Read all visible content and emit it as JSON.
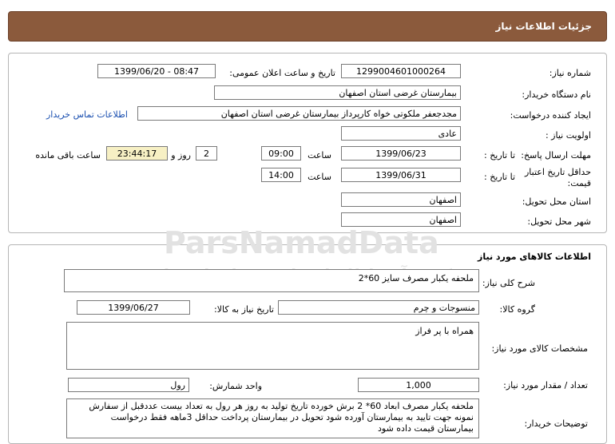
{
  "header": {
    "title": "جزئیات اطلاعات نیاز"
  },
  "info": {
    "need_number_label": "شماره نیاز:",
    "need_number": "1299004601000264",
    "announce_label": "تاریخ و ساعت اعلان عمومی:",
    "announce_value": "1399/06/20 - 08:47",
    "buyer_org_label": "نام دستگاه خریدار:",
    "buyer_org": "بیمارستان غرضی استان اصفهان",
    "creator_label": "ایجاد کننده درخواست:",
    "creator": "مجدجعفر ملکوتی خواه کارپرداز بیمارستان غرضی استان اصفهان",
    "contact_link": "اطلاعات تماس خریدار",
    "priority_label": "اولویت نیاز :",
    "priority": "عادی",
    "deadline_label": "مهلت ارسال پاسخ:",
    "until_date_label": "تا تاریخ :",
    "deadline_date": "1399/06/23",
    "time_label": "ساعت",
    "deadline_time": "09:00",
    "days": "2",
    "days_label": "روز و",
    "remaining_time": "23:44:17",
    "remaining_label": "ساعت باقی مانده",
    "validity_label": "حداقل تاریخ اعتبار قیمت:",
    "validity_date": "1399/06/31",
    "validity_time": "14:00",
    "province_label": "استان محل تحویل:",
    "province": "اصفهان",
    "city_label": "شهر محل تحویل:",
    "city": "اصفهان"
  },
  "goods": {
    "title": "اطلاعات کالاهای مورد نیاز",
    "summary_label": "شرح کلی نیاز:",
    "summary": "ملحفه یکبار مصرف سایز 60*2",
    "group_label": "گروه کالا:",
    "group": "منسوجات و چرم",
    "need_date_label": "تاریخ نیاز به کالا:",
    "need_date": "1399/06/27",
    "specs_label": "مشخصات کالای مورد نیاز:",
    "specs": "همراه با پر فراز",
    "qty_label": "تعداد / مقدار مورد نیاز:",
    "qty": "1,000",
    "unit_label": "واحد شمارش:",
    "unit": "رول",
    "buyer_notes_label": "توضیحات خریدار:",
    "buyer_notes": "ملحفه یکبار مصرف ابعاد 60* 2 برش خورده تاریخ تولید به روز هر رول به تعداد بیست عددقبل از سفارش نمونه جهت تایید به بیمارستان آورده شود تحویل در بیمارستان پرداخت حداقل 3ماهه فقط درخواست بیمارستان قیمت داده شود"
  },
  "watermark": {
    "line1": "ParsNamadData",
    "line2": "مرکز فرآیند اطلاعات پارس نماد داده ها",
    "line3": "۰۲۱-۸۸۳۴۹۶۷۰-۵"
  }
}
